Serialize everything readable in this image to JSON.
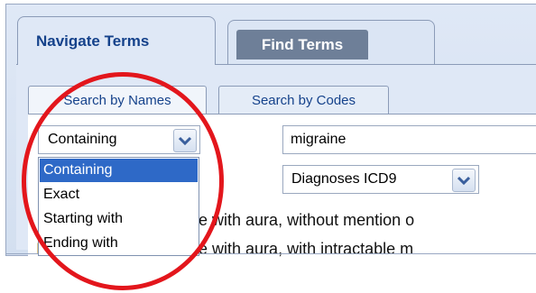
{
  "main_tabs": [
    {
      "label": "Navigate Terms"
    },
    {
      "label": "Find Terms"
    }
  ],
  "sub_tabs": [
    {
      "label": "Search by Names"
    },
    {
      "label": "Search by Codes"
    }
  ],
  "match_mode": {
    "selected": "Containing",
    "options": [
      "Containing",
      "Exact",
      "Starting with",
      "Ending with"
    ]
  },
  "search": {
    "value": "migraine"
  },
  "code_system": {
    "selected": "Diagnoses ICD9"
  },
  "results": [
    {
      "text": "raine with aura, without mention o"
    },
    {
      "text": "raine with aura, with intractable m"
    }
  ],
  "colors": {
    "annotation": "#e3161c",
    "selection": "#2e69c7",
    "tab_text": "#15428b"
  },
  "icons": {
    "dropdown_arrow": "chevron-down-icon",
    "folder": "folder-icon"
  }
}
